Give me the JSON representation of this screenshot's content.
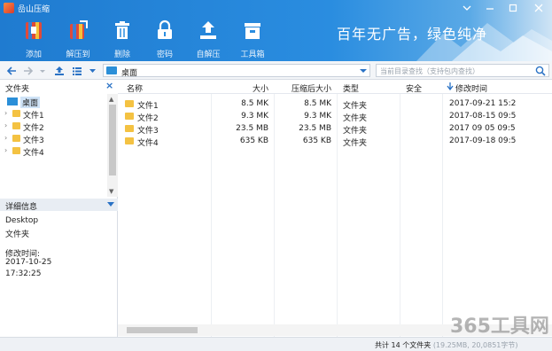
{
  "app": {
    "title": "嵒山压缩"
  },
  "window": {
    "menu_icon": "menu-icon",
    "min_icon": "minimize-icon",
    "max_icon": "maximize-icon",
    "close_icon": "close-icon"
  },
  "toolbar": {
    "items": [
      {
        "label": "添加",
        "icon": "add-archive-icon"
      },
      {
        "label": "解压到",
        "icon": "extract-icon"
      },
      {
        "label": "删除",
        "icon": "trash-icon"
      },
      {
        "label": "密码",
        "icon": "lock-icon"
      },
      {
        "label": "自解压",
        "icon": "upload-icon"
      },
      {
        "label": "工具箱",
        "icon": "toolbox-icon"
      }
    ],
    "slogan": "百年无广告，绿色纯净"
  },
  "nav": {
    "path": "桌面",
    "search_placeholder": "当前目录查找（支持包内查找）"
  },
  "folder_pane": {
    "header": "文件夹",
    "tree": [
      {
        "label": "桌面",
        "selected": true
      },
      {
        "label": "文件1"
      },
      {
        "label": "文件2"
      },
      {
        "label": "文件3"
      },
      {
        "label": "文件4"
      }
    ]
  },
  "details": {
    "header": "详细信息",
    "name": "Desktop",
    "type": "文件夹",
    "modified_label": "修改时间:",
    "modified_date": "2017-10-25",
    "modified_time": "17:32:25"
  },
  "file_list": {
    "columns": [
      "名称",
      "大小",
      "压缩后大小",
      "类型",
      "安全",
      "修改时间"
    ],
    "sort_column": "修改时间",
    "rows": [
      {
        "name": "文件1",
        "size": "8.5 MK",
        "packed": "8.5 MK",
        "type": "文件夹",
        "security": "",
        "modified": "2017-09-21 15:2"
      },
      {
        "name": "文件2",
        "size": "9.3 MK",
        "packed": "9.3 MK",
        "type": "文件夹",
        "security": "",
        "modified": "2017-08-15 09:5"
      },
      {
        "name": "文件3",
        "size": "23.5 MB",
        "packed": "23.5 MB",
        "type": "文件夹",
        "security": "",
        "modified": "2017 09 05 09:5"
      },
      {
        "name": "文件4",
        "size": "635 KB",
        "packed": "635 KB",
        "type": "文件夹",
        "security": "",
        "modified": "2017-09-18 09:5"
      }
    ]
  },
  "status": {
    "summary": "共计 14 个文件夹",
    "detail": "(19.25MB, 20,0851字节)"
  },
  "watermark": "365工具网"
}
